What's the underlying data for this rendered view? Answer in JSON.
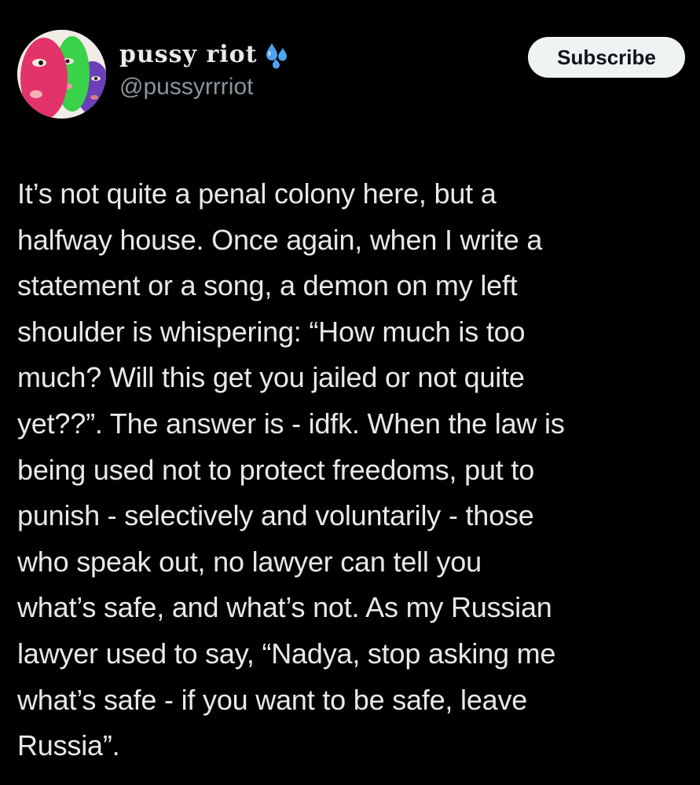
{
  "author": {
    "display_name": "pussy riot",
    "display_name_icon": "water-drops-icon",
    "handle": "@pussyrrriot",
    "avatar": "three-balaclavas-avatar"
  },
  "actions": {
    "subscribe_label": "Subscribe"
  },
  "tweet": {
    "lines": [
      "It’s not quite a penal colony here, but a",
      "halfway house. Once again, when I write a",
      "statement or a song, a demon on my left",
      "shoulder is whispering: “How much is too",
      "much? Will this get you jailed or not quite",
      "yet??”. The answer is - idfk. When the law is",
      "being used not to protect freedoms, put to",
      "punish - selectively and voluntarily - those",
      "who speak out, no lawyer can tell you",
      "what’s safe, and what’s not. As my Russian",
      "lawyer used to say, “Nadya, stop asking me",
      "what’s safe - if you want to be safe, leave",
      "Russia”."
    ]
  },
  "colors": {
    "background": "#000000",
    "text": "#e7e9ea",
    "secondary_text": "#8b949c",
    "button_bg": "#eff3f4",
    "button_text": "#0f1419"
  }
}
